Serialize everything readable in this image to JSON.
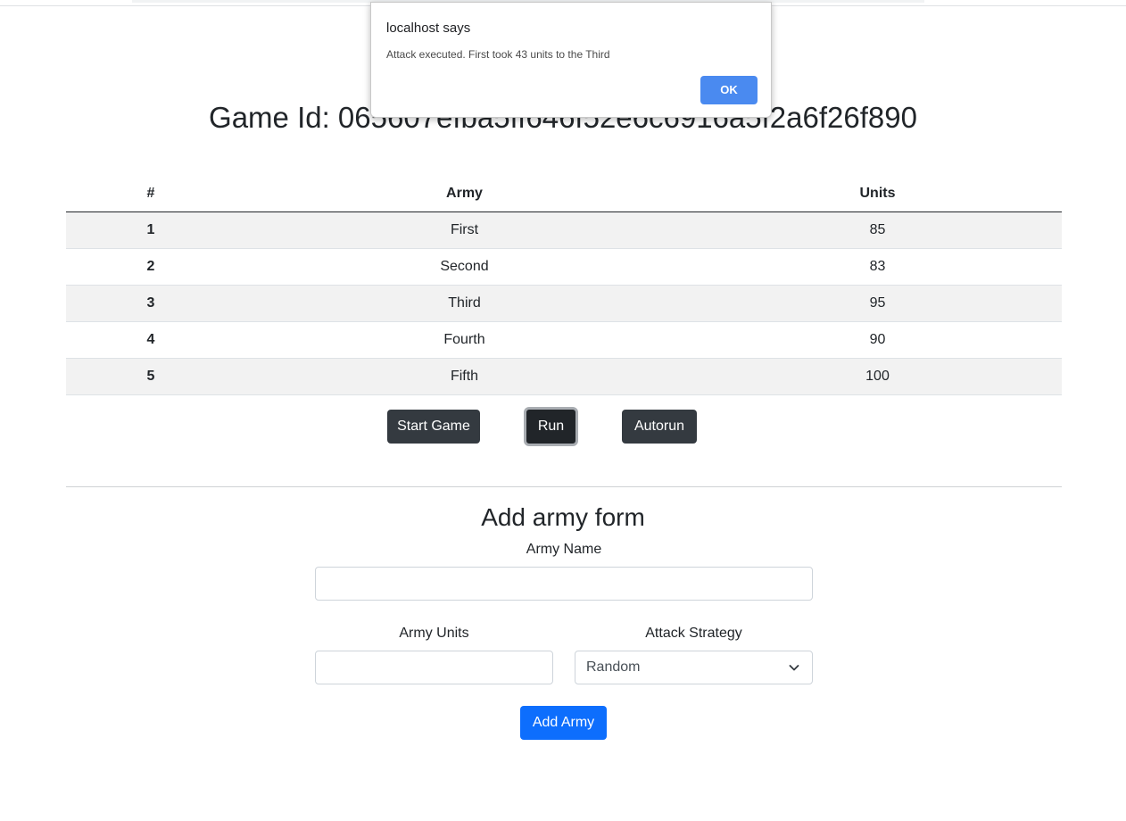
{
  "dialog": {
    "title": "localhost says",
    "message": "Attack executed. First took 43 units to the Third",
    "ok_label": "OK"
  },
  "game": {
    "title": "Game Id: 065607efba5ff646f52e6c6916a5f2a6f26f890"
  },
  "table": {
    "headers": {
      "index": "#",
      "army": "Army",
      "units": "Units"
    },
    "rows": [
      {
        "index": "1",
        "army": "First",
        "units": "85"
      },
      {
        "index": "2",
        "army": "Second",
        "units": "83"
      },
      {
        "index": "3",
        "army": "Third",
        "units": "95"
      },
      {
        "index": "4",
        "army": "Fourth",
        "units": "90"
      },
      {
        "index": "5",
        "army": "Fifth",
        "units": "100"
      }
    ]
  },
  "controls": {
    "start_label": "Start Game",
    "run_label": "Run",
    "autorun_label": "Autorun"
  },
  "form": {
    "title": "Add army form",
    "name_label": "Army Name",
    "name_value": "",
    "units_label": "Army Units",
    "units_value": "",
    "strategy_label": "Attack Strategy",
    "strategy_selected": "Random",
    "submit_label": "Add Army"
  },
  "colors": {
    "dark_button": "#343a40",
    "primary_button": "#0d6efd",
    "dialog_ok": "#4a8af0"
  },
  "icons": {
    "select_arrow": "chevron-down-icon"
  }
}
